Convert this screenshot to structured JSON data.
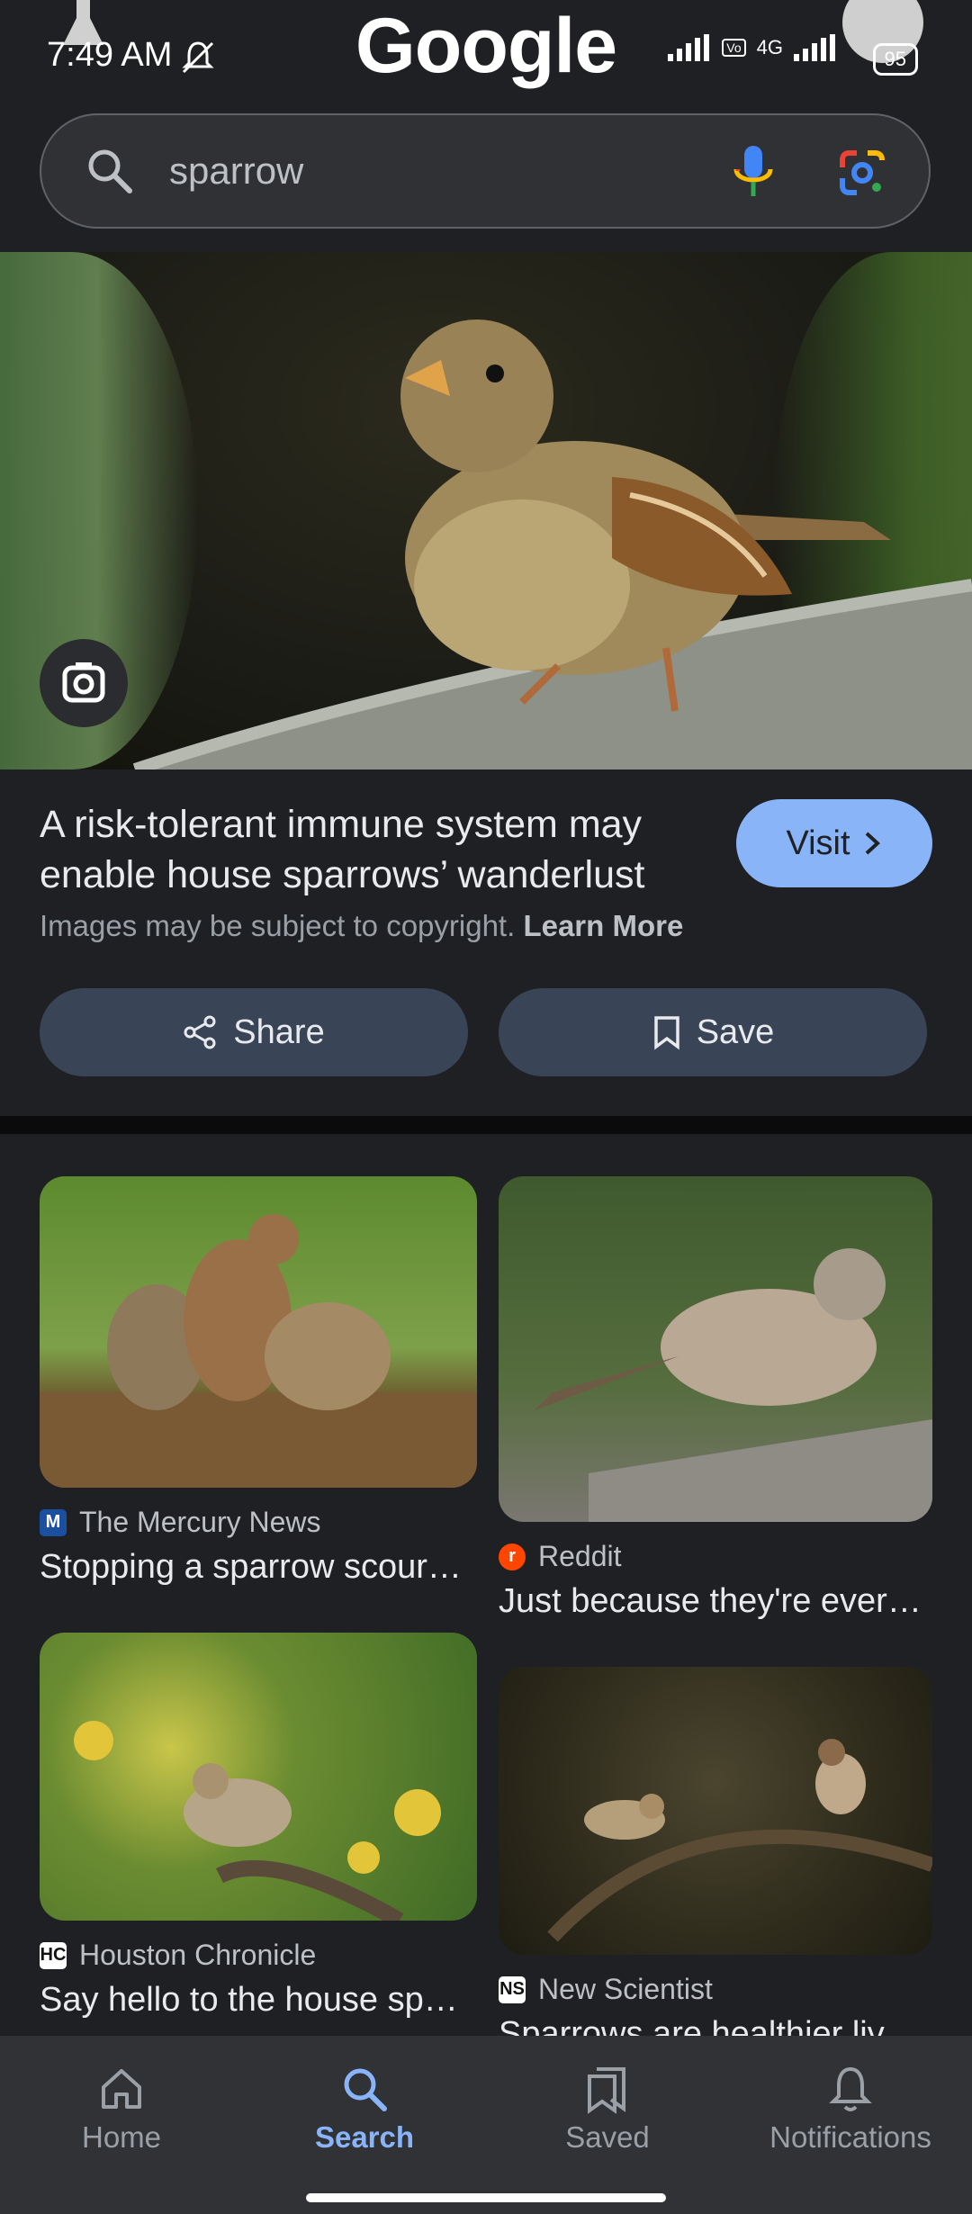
{
  "status_bar": {
    "time": "7:49 AM",
    "network": "4G",
    "battery": "95"
  },
  "header": {
    "logo": "Google"
  },
  "search": {
    "query": "sparrow"
  },
  "result": {
    "title": "A risk-tolerant immune system may enable house sparrows’ wanderlust",
    "visit_label": "Visit",
    "copyright_text": "Images may be subject to copyright.",
    "learn_more": "Learn More",
    "share_label": "Share",
    "save_label": "Save"
  },
  "grid": [
    {
      "source": "The Mercury News",
      "favicon": "M",
      "title": "Stopping a sparrow scour…"
    },
    {
      "source": "Reddit",
      "favicon": "r",
      "title": "Just because they're ever…"
    },
    {
      "source": "Houston Chronicle",
      "favicon": "HC",
      "title": "Say hello to the house sp…"
    },
    {
      "source": "New Scientist",
      "favicon": "NS",
      "title": "Sparrows are healthier liv…"
    }
  ],
  "nav": {
    "home": "Home",
    "search": "Search",
    "saved": "Saved",
    "notifications": "Notifications"
  },
  "colors": {
    "accent": "#8ab4f8",
    "background": "#1f2023",
    "chip": "#394457"
  }
}
